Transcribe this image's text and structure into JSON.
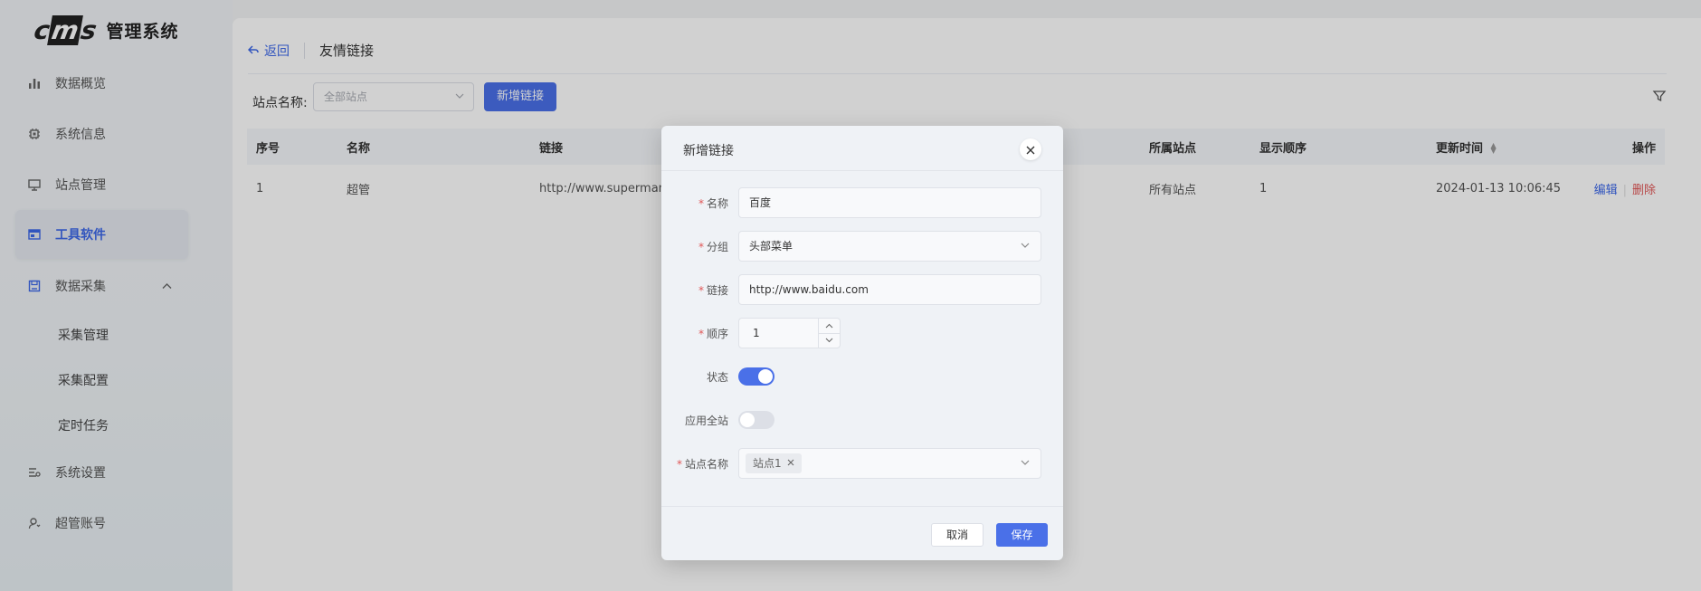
{
  "brand": {
    "logo_text": "cms",
    "name": "管理系统"
  },
  "sidebar": {
    "items": [
      {
        "label": "数据概览",
        "icon": "bar-chart-icon"
      },
      {
        "label": "系统信息",
        "icon": "chip-icon"
      },
      {
        "label": "站点管理",
        "icon": "monitor-icon"
      },
      {
        "label": "工具软件",
        "icon": "window-icon",
        "active": true
      },
      {
        "label": "数据采集",
        "icon": "save-icon",
        "expanded": true
      },
      {
        "label": "系统设置",
        "icon": "settings-list-icon"
      },
      {
        "label": "超管账号",
        "icon": "user-icon"
      }
    ],
    "sub_items": [
      "采集管理",
      "采集配置",
      "定时任务"
    ]
  },
  "header": {
    "back_label": "返回",
    "title": "友情链接"
  },
  "filter": {
    "site_label": "站点名称:",
    "site_placeholder": "全部站点",
    "add_button": "新增链接"
  },
  "table": {
    "columns": [
      "序号",
      "名称",
      "链接",
      "所属站点",
      "显示顺序",
      "更新时间",
      "操作"
    ],
    "rows": [
      {
        "index": "1",
        "name": "超管",
        "link": "http://www.superman.c",
        "site": "所有站点",
        "order": "1",
        "updated": "2024-01-13 10:06:45"
      }
    ],
    "actions": {
      "edit": "编辑",
      "delete": "删除"
    }
  },
  "dialog": {
    "title": "新增链接",
    "fields": {
      "name_label": "名称",
      "name_value": "百度",
      "group_label": "分组",
      "group_value": "头部菜单",
      "link_label": "链接",
      "link_value": "http://www.baidu.com",
      "order_label": "顺序",
      "order_value": "1",
      "status_label": "状态",
      "status_on": true,
      "apply_all_label": "应用全站",
      "apply_all_on": false,
      "site_label": "站点名称",
      "site_tag": "站点1"
    },
    "cancel": "取消",
    "save": "保存"
  },
  "colors": {
    "accent": "#4a70e8",
    "danger": "#e05555"
  }
}
